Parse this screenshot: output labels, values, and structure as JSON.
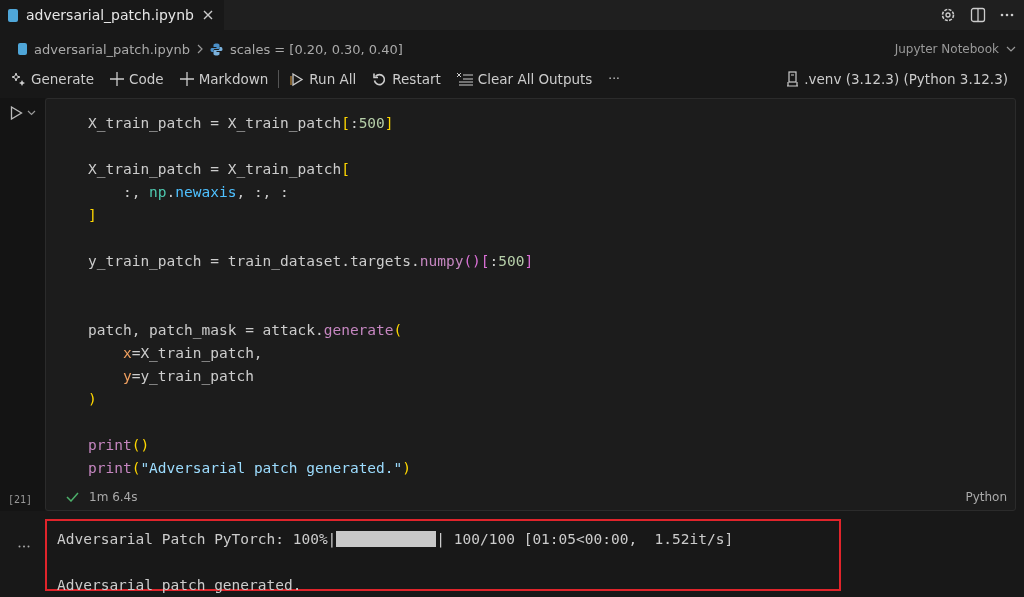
{
  "tab": {
    "title": "adversarial_patch.ipynb",
    "selected": true
  },
  "breadcrumb": {
    "file": "adversarial_patch.ipynb",
    "symbol": "scales = [0.20, 0.30, 0.40]",
    "view": "Jupyter Notebook"
  },
  "toolbar": {
    "items": [
      {
        "label": "Generate",
        "kind": "sparkle"
      },
      {
        "label": "Code",
        "kind": "plus"
      },
      {
        "label": "Markdown",
        "kind": "plus"
      },
      {
        "label": "Run All",
        "kind": "run"
      },
      {
        "label": "Restart",
        "kind": "restart"
      },
      {
        "label": "Clear All Outputs",
        "kind": "clear"
      }
    ],
    "more": "···",
    "kernel": ".venv (3.12.3) (Python 3.12.3)"
  },
  "cell": {
    "execution_count": "[21]",
    "status": "1m 6.4s",
    "succeeded": true,
    "language": "Python",
    "lines": [
      {
        "kind": "code",
        "tokens": [
          {
            "text": "X_train_patch = X_train_patch",
            "kind": "plain"
          },
          {
            "text": "[",
            "kind": "bracket"
          },
          {
            "text": ":",
            "kind": "plain"
          },
          {
            "text": "500",
            "kind": "number"
          },
          {
            "text": "]",
            "kind": "bracket"
          }
        ]
      },
      {
        "kind": "blank"
      },
      {
        "kind": "code",
        "tokens": [
          {
            "text": "X_train_patch = X_train_patch",
            "kind": "plain"
          },
          {
            "text": "[",
            "kind": "bracket"
          }
        ]
      },
      {
        "kind": "code",
        "tokens": [
          {
            "text": "    :, ",
            "kind": "plain"
          },
          {
            "text": "np",
            "kind": "module"
          },
          {
            "text": ".",
            "kind": "plain"
          },
          {
            "text": "newaxis",
            "kind": "attr"
          },
          {
            "text": ", :, :",
            "kind": "plain"
          }
        ]
      },
      {
        "kind": "code",
        "tokens": [
          {
            "text": "]",
            "kind": "bracket"
          }
        ]
      },
      {
        "kind": "blank"
      },
      {
        "kind": "code",
        "tokens": [
          {
            "text": "y_train_patch = train_dataset.targets.",
            "kind": "plain"
          },
          {
            "text": "numpy",
            "kind": "func"
          },
          {
            "text": "()",
            "kind": "bracket2"
          },
          {
            "text": "[",
            "kind": "bracket2"
          },
          {
            "text": ":",
            "kind": "plain"
          },
          {
            "text": "500",
            "kind": "number"
          },
          {
            "text": "]",
            "kind": "bracket2"
          }
        ]
      },
      {
        "kind": "blank"
      },
      {
        "kind": "blank"
      },
      {
        "kind": "code",
        "tokens": [
          {
            "text": "patch, patch_mask = attack.",
            "kind": "plain"
          },
          {
            "text": "generate",
            "kind": "func"
          },
          {
            "text": "(",
            "kind": "bracket"
          }
        ]
      },
      {
        "kind": "code",
        "tokens": [
          {
            "text": "    x",
            "kind": "param"
          },
          {
            "text": "=X_train_patch,",
            "kind": "plain"
          }
        ]
      },
      {
        "kind": "code",
        "tokens": [
          {
            "text": "    y",
            "kind": "param"
          },
          {
            "text": "=y_train_patch",
            "kind": "plain"
          }
        ]
      },
      {
        "kind": "code",
        "tokens": [
          {
            "text": ")",
            "kind": "bracket"
          }
        ]
      },
      {
        "kind": "blank"
      },
      {
        "kind": "code",
        "tokens": [
          {
            "text": "print",
            "kind": "func"
          },
          {
            "text": "()",
            "kind": "bracket"
          }
        ]
      },
      {
        "kind": "code",
        "tokens": [
          {
            "text": "print",
            "kind": "func"
          },
          {
            "text": "(",
            "kind": "bracket"
          },
          {
            "text": "\"Adversarial patch generated.\"",
            "kind": "string"
          },
          {
            "text": ")",
            "kind": "bracket"
          }
        ]
      }
    ]
  },
  "output": {
    "progress": {
      "prefix": "Adversarial Patch PyTorch: 100%|",
      "level": 1.0,
      "suffix": "| 100/100 [01:05<00:00,  1.52it/s]"
    },
    "message": "Adversarial patch generated.",
    "highlighted": true
  }
}
